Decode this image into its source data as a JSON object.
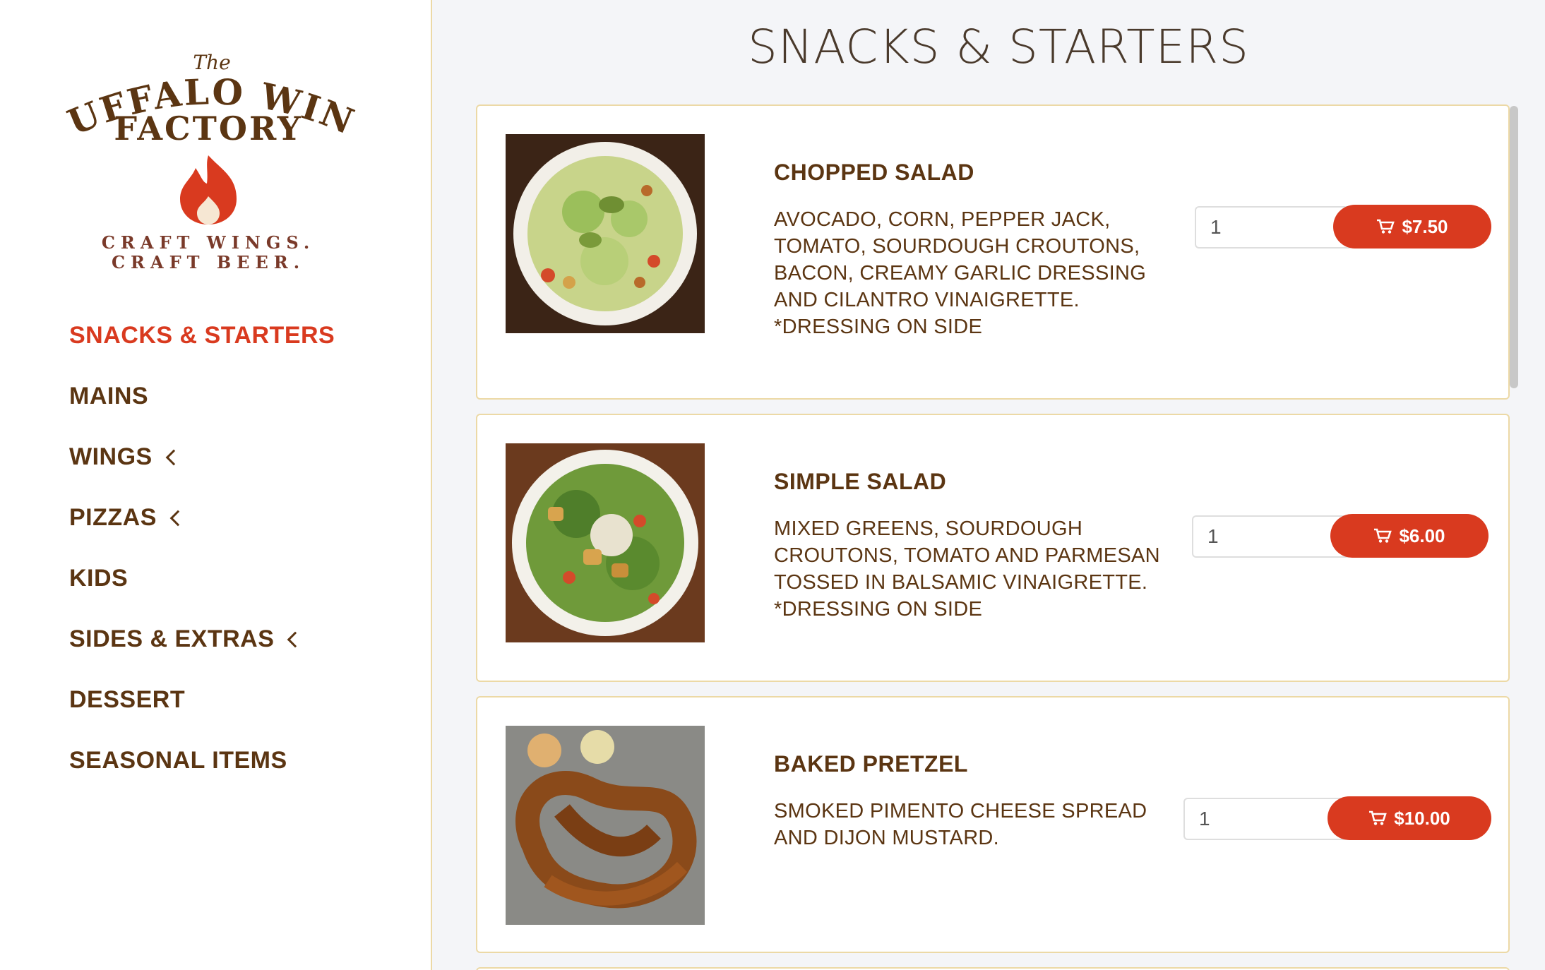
{
  "brand": {
    "logo_top": "The",
    "logo_line1": "BUFFALO WING",
    "logo_line2": "FACTORY",
    "logo_tag1": "CRAFT WINGS.",
    "logo_tag2": "CRAFT BEER."
  },
  "nav": {
    "items": [
      {
        "label": "SNACKS & STARTERS",
        "active": true,
        "has_submenu": false
      },
      {
        "label": "MAINS",
        "active": false,
        "has_submenu": false
      },
      {
        "label": "WINGS",
        "active": false,
        "has_submenu": true
      },
      {
        "label": "PIZZAS",
        "active": false,
        "has_submenu": true
      },
      {
        "label": "KIDS",
        "active": false,
        "has_submenu": false
      },
      {
        "label": "SIDES & EXTRAS",
        "active": false,
        "has_submenu": true
      },
      {
        "label": "DESSERT",
        "active": false,
        "has_submenu": false
      },
      {
        "label": "SEASONAL ITEMS",
        "active": false,
        "has_submenu": false
      }
    ]
  },
  "main": {
    "title": "SNACKS & STARTERS",
    "items": [
      {
        "name": "CHOPPED SALAD",
        "description": [
          "AVOCADO, CORN, PEPPER JACK,",
          "TOMATO, SOURDOUGH CROUTONS,",
          "BACON, CREAMY GARLIC DRESSING",
          "AND CILANTRO VINAIGRETTE.",
          "*DRESSING ON SIDE"
        ],
        "quantity": "1",
        "price": "$7.50",
        "image": "chopped-salad-photo"
      },
      {
        "name": "SIMPLE SALAD",
        "description": [
          "MIXED GREENS, SOURDOUGH",
          "CROUTONS, TOMATO AND PARMESAN",
          "TOSSED IN BALSAMIC VINAIGRETTE.",
          "*DRESSING ON SIDE"
        ],
        "quantity": "1",
        "price": "$6.00",
        "image": "simple-salad-photo"
      },
      {
        "name": "BAKED PRETZEL",
        "description": [
          "SMOKED PIMENTO CHEESE SPREAD",
          "AND DIJON MUSTARD."
        ],
        "quantity": "1",
        "price": "$10.00",
        "image": "baked-pretzel-photo"
      }
    ]
  },
  "colors": {
    "accent": "#d93a1f",
    "brown": "#5b3512",
    "card_border": "#ecd9a6",
    "background": "#f4f5f8"
  },
  "icons": {
    "cart": "cart-icon",
    "chevron": "chevron-left-icon",
    "flame": "flame-icon"
  }
}
